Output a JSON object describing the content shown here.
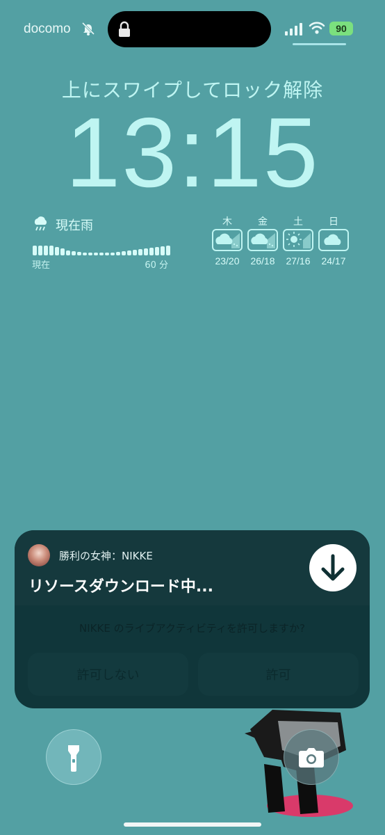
{
  "status_bar": {
    "carrier": "docomo",
    "battery": "90",
    "icons": [
      "bell-slash-icon",
      "lock-icon",
      "cellular-signal-icon",
      "wifi-icon",
      "battery-icon"
    ]
  },
  "lock": {
    "swipe_hint": "上にスワイプしてロック解除",
    "time": "13:15"
  },
  "rain_widget": {
    "title": "現在雨",
    "start_label": "現在",
    "end_label": "60 分",
    "icon": "rain-cloud-icon"
  },
  "forecast": {
    "days": [
      {
        "day": "木",
        "temp": "23/20",
        "icon": "cloud-rain-icon"
      },
      {
        "day": "金",
        "temp": "26/18",
        "icon": "cloud-rain-icon"
      },
      {
        "day": "土",
        "temp": "27/16",
        "icon": "sun-rain-icon"
      },
      {
        "day": "日",
        "temp": "24/17",
        "icon": "cloud-icon"
      }
    ]
  },
  "notification": {
    "app_name": "勝利の女神：NIKKE",
    "title": "リソースダウンロード中...",
    "question": "NIKKE のライブアクティビティを許可しますか?",
    "deny_label": "許可しない",
    "allow_label": "許可",
    "action_icon": "download-arrow-icon"
  },
  "bottom_controls": {
    "flashlight": "flashlight-icon",
    "camera": "camera-icon"
  },
  "colors": {
    "background": "#53a0a3",
    "text_accent": "#bff5f2",
    "battery_green": "#7be07e",
    "notification_bg": "#10363a"
  }
}
